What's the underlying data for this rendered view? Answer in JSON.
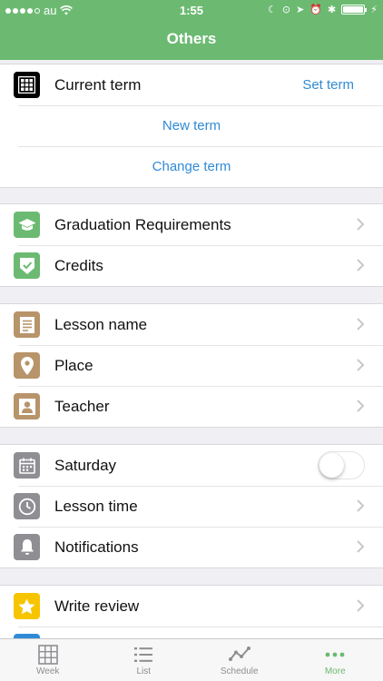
{
  "status_bar": {
    "carrier": "au",
    "time": "1:55"
  },
  "header": {
    "title": "Others"
  },
  "term_section": {
    "current_term_label": "Current term",
    "set_term_label": "Set term",
    "new_term_label": "New term",
    "change_term_label": "Change term"
  },
  "requirements_section": {
    "items": [
      {
        "label": "Graduation Requirements",
        "icon": "graduation-cap-icon",
        "color": "#6cba72"
      },
      {
        "label": "Credits",
        "icon": "check-shield-icon",
        "color": "#6cba72"
      }
    ]
  },
  "lesson_section": {
    "items": [
      {
        "label": "Lesson name",
        "icon": "document-lines-icon",
        "color": "#b8946a"
      },
      {
        "label": "Place",
        "icon": "map-pin-icon",
        "color": "#b8946a"
      },
      {
        "label": "Teacher",
        "icon": "person-icon",
        "color": "#b8946a"
      }
    ]
  },
  "settings_section": {
    "saturday_label": "Saturday",
    "saturday_enabled": false,
    "lesson_time_label": "Lesson time",
    "notifications_label": "Notifications",
    "icon_color": "#8e8e93"
  },
  "feedback_section": {
    "write_review_label": "Write review",
    "write_review_icon_color": "#f7c500"
  },
  "tab_bar": {
    "tabs": [
      {
        "label": "Week",
        "icon": "grid-icon",
        "active": false
      },
      {
        "label": "List",
        "icon": "list-icon",
        "active": false
      },
      {
        "label": "Schedule",
        "icon": "chart-line-icon",
        "active": false
      },
      {
        "label": "More",
        "icon": "more-dots-icon",
        "active": true
      }
    ],
    "active_color": "#6cba72",
    "inactive_color": "#8e8e93"
  }
}
